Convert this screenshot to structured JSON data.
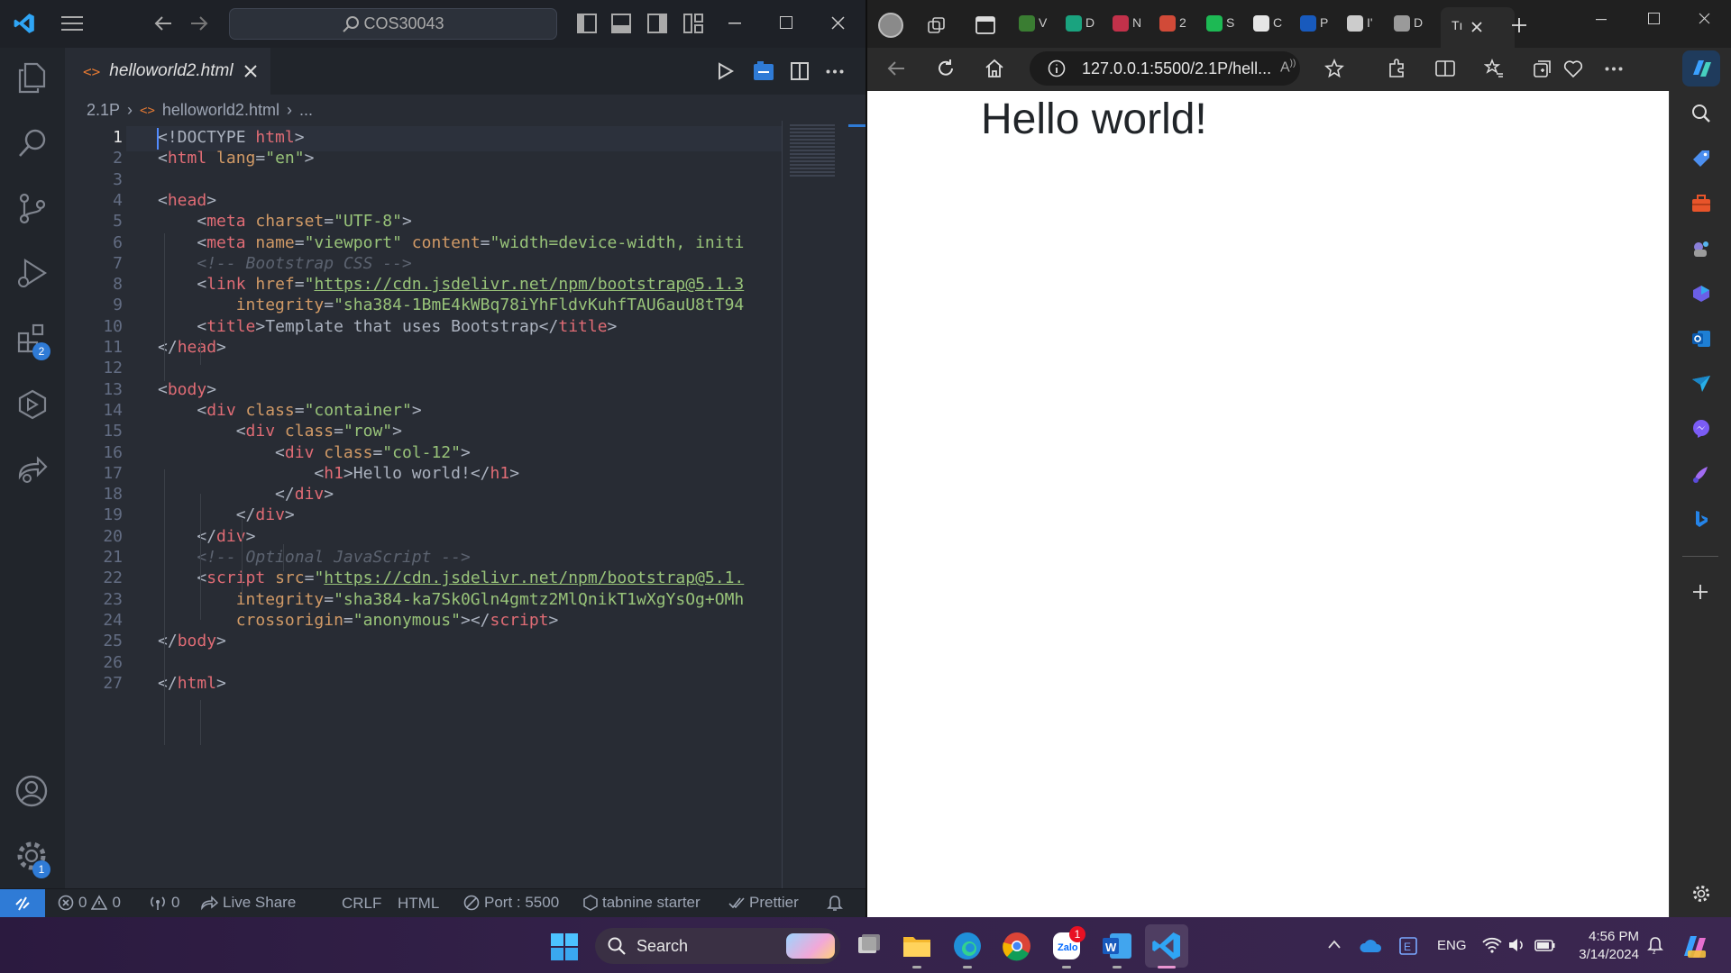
{
  "vscode": {
    "search_text": "COS30043",
    "tab_label": "helloworld2.html",
    "breadcrumb": {
      "folder": "2.1P",
      "file": "helloworld2.html",
      "more": "..."
    },
    "line_numbers": [
      "1",
      "2",
      "3",
      "4",
      "5",
      "6",
      "7",
      "8",
      "9",
      "10",
      "11",
      "12",
      "13",
      "14",
      "15",
      "16",
      "17",
      "18",
      "19",
      "20",
      "21",
      "22",
      "23",
      "24",
      "25",
      "26",
      "27"
    ],
    "extensions_badge": "2",
    "settings_badge": "1",
    "code": {
      "l1": {
        "p1": "<!DOCTYPE",
        "t1": " html",
        "p2": ">"
      },
      "l2": {
        "p1": "<",
        "t1": "html",
        "a1": " lang",
        "p2": "=",
        "s1": "\"en\"",
        "p3": ">"
      },
      "l4": {
        "p1": "<",
        "t1": "head",
        "p2": ">"
      },
      "l5": {
        "p1": "<",
        "t1": "meta",
        "a1": " charset",
        "p2": "=",
        "s1": "\"UTF-8\"",
        "p3": ">"
      },
      "l6": {
        "p1": "<",
        "t1": "meta",
        "a1": " name",
        "p2": "=",
        "s1": "\"viewport\"",
        "a2": " content",
        "p3": "=",
        "s2": "\"width=device-width, initi"
      },
      "l7": {
        "c1": "<!-- Bootstrap CSS -->"
      },
      "l8": {
        "p1": "<",
        "t1": "link",
        "a1": " href",
        "p2": "=",
        "q1": "\"",
        "s1": "https://cdn.jsdelivr.net/npm/bootstrap@5.1.3"
      },
      "l9": {
        "a1": "integrity",
        "p1": "=",
        "s1": "\"sha384-1BmE4kWBq78iYhFldvKuhfTAU6auU8tT94"
      },
      "l10": {
        "p1": "<",
        "t1": "title",
        "p2": ">",
        "x1": "Template that uses Bootstrap",
        "p3": "</",
        "t2": "title",
        "p4": ">"
      },
      "l11": {
        "p1": "</",
        "t1": "head",
        "p2": ">"
      },
      "l13": {
        "p1": "<",
        "t1": "body",
        "p2": ">"
      },
      "l14": {
        "p1": "<",
        "t1": "div",
        "a1": " class",
        "p2": "=",
        "s1": "\"container\"",
        "p3": ">"
      },
      "l15": {
        "p1": "<",
        "t1": "div",
        "a1": " class",
        "p2": "=",
        "s1": "\"row\"",
        "p3": ">"
      },
      "l16": {
        "p1": "<",
        "t1": "div",
        "a1": " class",
        "p2": "=",
        "s1": "\"col-12\"",
        "p3": ">"
      },
      "l17": {
        "p1": "<",
        "t1": "h1",
        "p2": ">",
        "x1": "Hello world!",
        "p3": "</",
        "t2": "h1",
        "p4": ">"
      },
      "l18": {
        "p1": "</",
        "t1": "div",
        "p2": ">"
      },
      "l19": {
        "p1": "</",
        "t1": "div",
        "p2": ">"
      },
      "l20": {
        "p1": "</",
        "t1": "div",
        "p2": ">"
      },
      "l21": {
        "c1": "<!-- Optional JavaScript -->"
      },
      "l22": {
        "p1": "<",
        "t1": "script",
        "a1": " src",
        "p2": "=",
        "q1": "\"",
        "s1": "https://cdn.jsdelivr.net/npm/bootstrap@5.1."
      },
      "l23": {
        "a1": "integrity",
        "p1": "=",
        "s1": "\"sha384-ka7Sk0Gln4gmtz2MlQnikT1wXgYsOg+OMh"
      },
      "l24": {
        "a1": "crossorigin",
        "p1": "=",
        "s1": "\"anonymous\"",
        "p2": "></",
        "t1": "script",
        "p3": ">"
      },
      "l25": {
        "p1": "</",
        "t1": "body",
        "p2": ">"
      },
      "l27": {
        "p1": "</",
        "t1": "html",
        "p2": ">"
      }
    },
    "status": {
      "errors": "0",
      "warnings": "0",
      "ports": "0",
      "live_share": "Live Share",
      "eol": "CRLF",
      "language": "HTML",
      "port": "Port : 5500",
      "tabnine": "tabnine starter",
      "prettier": "Prettier"
    }
  },
  "browser": {
    "url": "127.0.0.1:5500/2.1P/hell...",
    "tab_letters": [
      "V",
      "D",
      "N",
      "2",
      "S",
      "C",
      "P",
      "I'",
      "D",
      "Tı"
    ],
    "page_heading": "Hello world!"
  },
  "taskbar": {
    "search_label": "Search",
    "language": "ENG",
    "time": "4:56 PM",
    "date": "3/14/2024",
    "zalo_badge": "1"
  },
  "colors": {
    "vscode_accent": "#007acc",
    "edge_accent": "#2f7bd6"
  }
}
